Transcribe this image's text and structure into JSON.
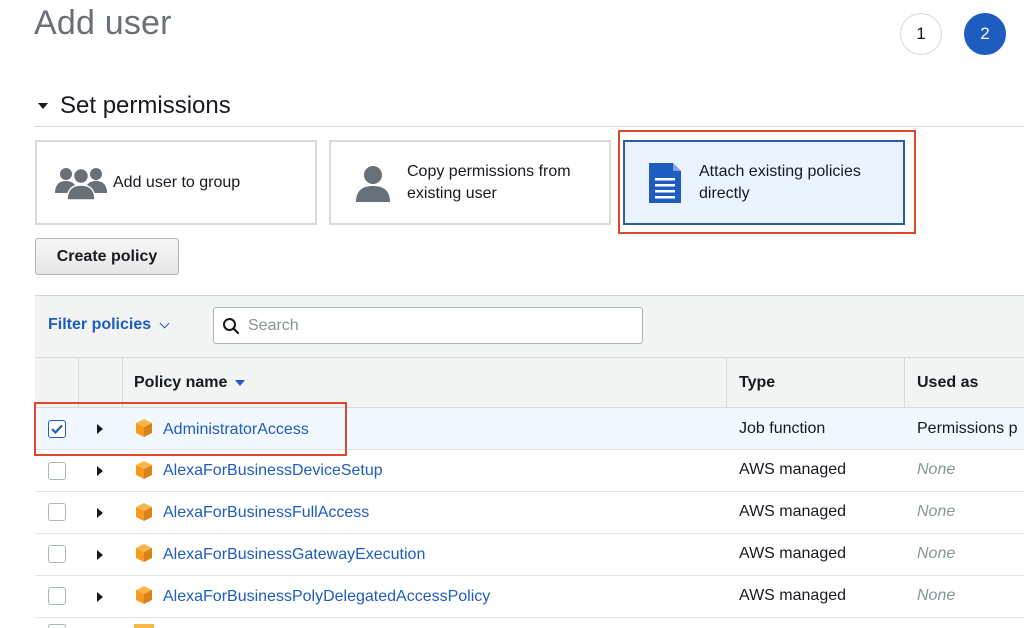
{
  "header": {
    "title": "Add user",
    "steps": [
      "1",
      "2"
    ]
  },
  "section": {
    "title": "Set permissions"
  },
  "options": [
    {
      "label_lines": [
        "Add user to group"
      ],
      "icon": "users-group-icon"
    },
    {
      "label_lines": [
        "Copy permissions from",
        "existing user"
      ],
      "icon": "user-icon"
    },
    {
      "label_lines": [
        "Attach existing policies",
        "directly"
      ],
      "icon": "document-icon"
    }
  ],
  "buttons": {
    "create_policy": "Create policy"
  },
  "filter": {
    "label": "Filter policies",
    "search_placeholder": "Search"
  },
  "table": {
    "columns": {
      "policy_name": "Policy name",
      "type": "Type",
      "used_as": "Used as"
    },
    "rows": [
      {
        "name": "AdministratorAccess",
        "type": "Job function",
        "used_as": "Permissions p",
        "checked": true
      },
      {
        "name": "AlexaForBusinessDeviceSetup",
        "type": "AWS managed",
        "used_as": "None",
        "checked": false
      },
      {
        "name": "AlexaForBusinessFullAccess",
        "type": "AWS managed",
        "used_as": "None",
        "checked": false
      },
      {
        "name": "AlexaForBusinessGatewayExecution",
        "type": "AWS managed",
        "used_as": "None",
        "checked": false
      },
      {
        "name": "AlexaForBusinessPolyDelegatedAccessPolicy",
        "type": "AWS managed",
        "used_as": "None",
        "checked": false
      }
    ]
  },
  "colors": {
    "accent": "#1f5cbf",
    "highlight": "#e0452f",
    "selected_bg": "#f1f8ff",
    "icon_orange": "#f79a1d"
  }
}
